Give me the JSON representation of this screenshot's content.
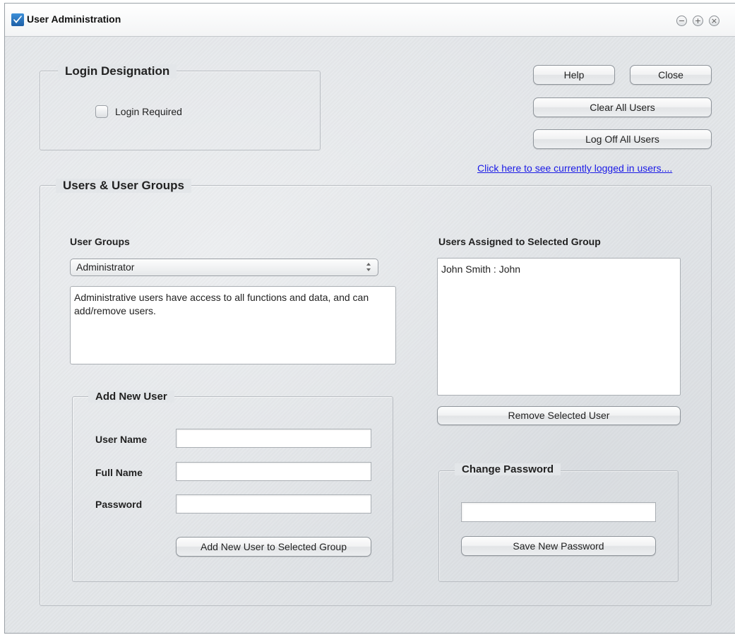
{
  "window": {
    "title": "User Administration",
    "controls": [
      {
        "name": "minimize",
        "glyph": "−"
      },
      {
        "name": "maximize",
        "glyph": "+"
      },
      {
        "name": "close",
        "glyph": "×"
      }
    ]
  },
  "login_designation": {
    "legend": "Login Designation",
    "login_required_label": "Login Required",
    "login_required_checked": false
  },
  "actions": {
    "help": "Help",
    "close": "Close",
    "clear_all_users": "Clear All Users",
    "log_off_all_users": "Log Off All Users",
    "logged_in_link": "Click here to see currently logged in users...."
  },
  "users_groups": {
    "legend": "Users & User Groups",
    "user_groups_label": "User Groups",
    "selected_group": "Administrator",
    "group_description": "Administrative users have access to all functions and data, and can add/remove users.",
    "assigned_label": "Users Assigned to Selected Group",
    "assigned_users": [
      "John Smith : John"
    ],
    "remove_button": "Remove Selected User"
  },
  "add_user": {
    "legend": "Add New User",
    "user_name_label": "User Name",
    "user_name_value": "",
    "full_name_label": "Full Name",
    "full_name_value": "",
    "password_label": "Password",
    "password_value": "",
    "add_button": "Add New User to Selected Group"
  },
  "change_password": {
    "legend": "Change Password",
    "new_password_value": "",
    "save_button": "Save New Password"
  },
  "colors": {
    "link": "#1a1ae6",
    "app_icon": "#2a76c4",
    "window_bg": "#e3e6e9"
  }
}
